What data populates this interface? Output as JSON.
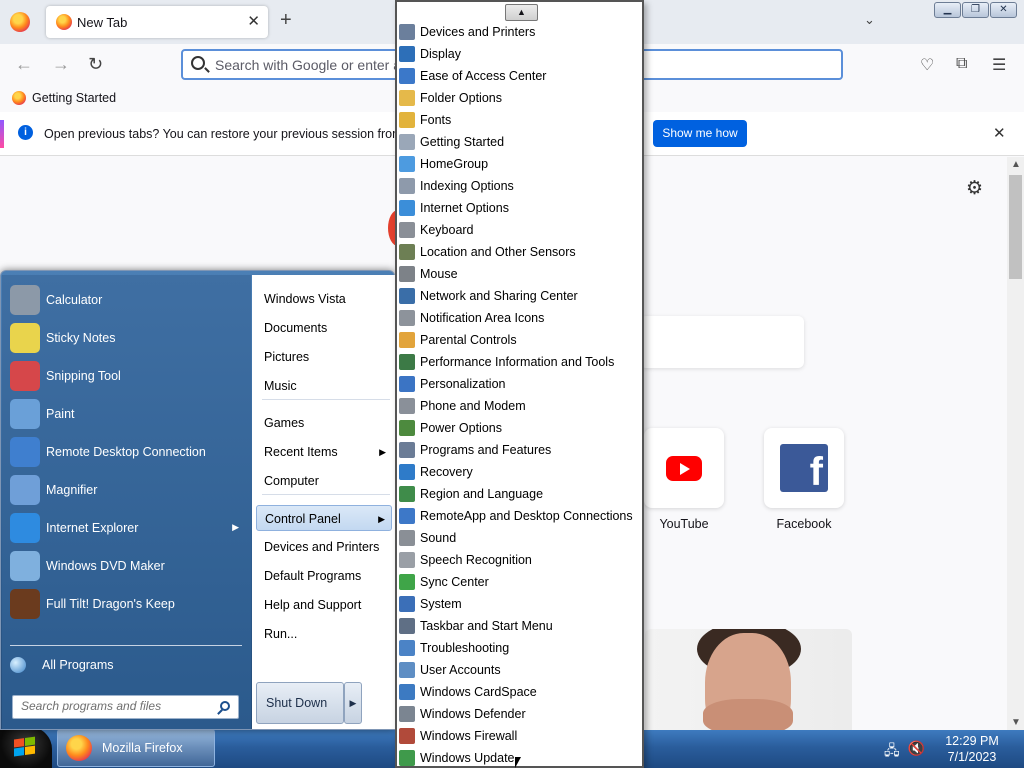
{
  "browser": {
    "tab_title": "New Tab",
    "url_placeholder": "Search with Google or enter address",
    "bookmark": "Getting Started",
    "notification": {
      "bold_text": "Open previous tabs?",
      "text": " You can restore your previous session from the Firefox application menu",
      "button": "Show me how"
    },
    "shortcuts": [
      {
        "label": "YouTube"
      },
      {
        "label": "Facebook"
      }
    ]
  },
  "start_menu": {
    "pinned": [
      {
        "label": "Calculator",
        "color": "#8c99a8"
      },
      {
        "label": "Sticky Notes",
        "color": "#e9d44c"
      },
      {
        "label": "Snipping Tool",
        "color": "#d6474a"
      },
      {
        "label": "Paint",
        "color": "#6aa0d8"
      },
      {
        "label": "Remote Desktop Connection",
        "color": "#3f7fcf"
      },
      {
        "label": "Magnifier",
        "color": "#6f9fd8"
      },
      {
        "label": "Internet Explorer",
        "color": "#2e8be0"
      },
      {
        "label": "Windows DVD Maker",
        "color": "#7fb0de"
      },
      {
        "label": "Full Tilt! Dragon's Keep",
        "color": "#6b3b1e"
      }
    ],
    "all_programs": "All Programs",
    "search_placeholder": "Search programs and files",
    "right_items": [
      "Windows Vista",
      "Documents",
      "Pictures",
      "Music",
      "Games",
      "Recent Items",
      "Computer",
      "Control Panel",
      "Devices and Printers",
      "Default Programs",
      "Help and Support",
      "Run..."
    ],
    "shutdown": "Shut Down"
  },
  "control_panel": [
    {
      "label": "Devices and Printers",
      "color": "#6b7f9c"
    },
    {
      "label": "Display",
      "color": "#2d6fb8"
    },
    {
      "label": "Ease of Access Center",
      "color": "#3b78c9"
    },
    {
      "label": "Folder Options",
      "color": "#e5b94a"
    },
    {
      "label": "Fonts",
      "color": "#e2b33c"
    },
    {
      "label": "Getting Started",
      "color": "#9aa7b8"
    },
    {
      "label": "HomeGroup",
      "color": "#4d9be0"
    },
    {
      "label": "Indexing Options",
      "color": "#8e9aab"
    },
    {
      "label": "Internet Options",
      "color": "#3b8ed9"
    },
    {
      "label": "Keyboard",
      "color": "#8a8f97"
    },
    {
      "label": "Location and Other Sensors",
      "color": "#6d7f54"
    },
    {
      "label": "Mouse",
      "color": "#7d8288"
    },
    {
      "label": "Network and Sharing Center",
      "color": "#3a6ea8"
    },
    {
      "label": "Notification Area Icons",
      "color": "#8d939b"
    },
    {
      "label": "Parental Controls",
      "color": "#e2a43b"
    },
    {
      "label": "Performance Information and Tools",
      "color": "#3c7a46"
    },
    {
      "label": "Personalization",
      "color": "#3b74c4"
    },
    {
      "label": "Phone and Modem",
      "color": "#8a9099"
    },
    {
      "label": "Power Options",
      "color": "#4d8a3e"
    },
    {
      "label": "Programs and Features",
      "color": "#6b7c96"
    },
    {
      "label": "Recovery",
      "color": "#2e7bc9"
    },
    {
      "label": "Region and Language",
      "color": "#3f8c4a"
    },
    {
      "label": "RemoteApp and Desktop Connections",
      "color": "#3d78c8"
    },
    {
      "label": "Sound",
      "color": "#8a8f96"
    },
    {
      "label": "Speech Recognition",
      "color": "#9a9fa6"
    },
    {
      "label": "Sync Center",
      "color": "#3fa548"
    },
    {
      "label": "System",
      "color": "#3b6fb8"
    },
    {
      "label": "Taskbar and Start Menu",
      "color": "#5f6f85"
    },
    {
      "label": "Troubleshooting",
      "color": "#4b83c6"
    },
    {
      "label": "User Accounts",
      "color": "#5e8ec4"
    },
    {
      "label": "Windows CardSpace",
      "color": "#3c7ac2"
    },
    {
      "label": "Windows Defender",
      "color": "#7b8591"
    },
    {
      "label": "Windows Firewall",
      "color": "#b14a3a"
    },
    {
      "label": "Windows Update",
      "color": "#3f9a4b"
    }
  ],
  "taskbar": {
    "firefox_label": "Mozilla Firefox",
    "time": "12:29 PM",
    "date": "7/1/2023"
  }
}
